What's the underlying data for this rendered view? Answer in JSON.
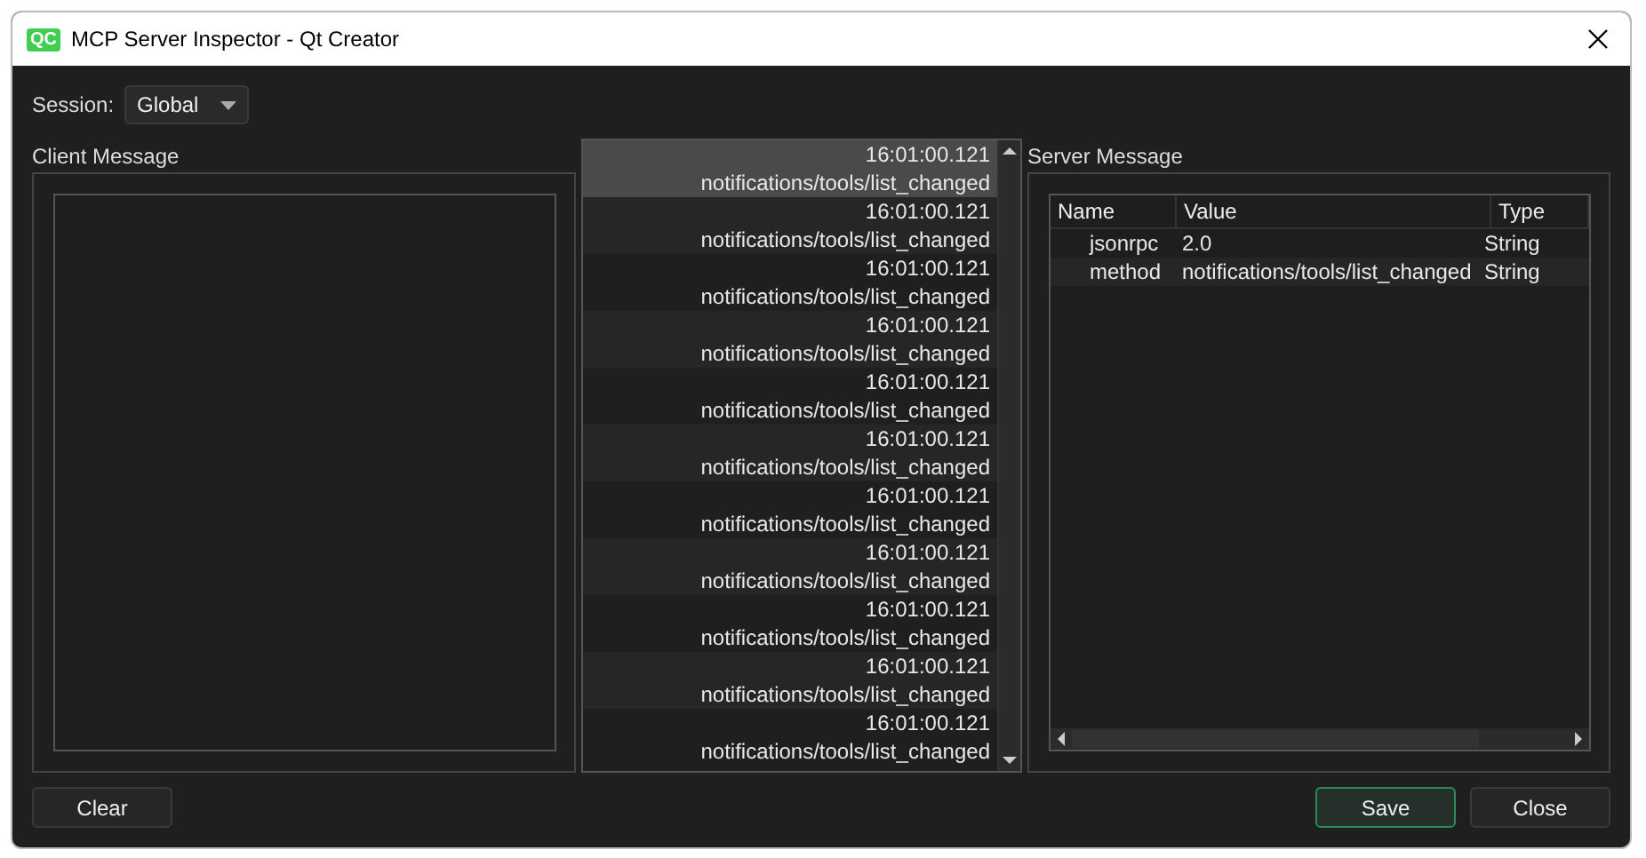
{
  "window": {
    "title": "MCP Server Inspector - Qt Creator",
    "icon_text": "QC"
  },
  "session": {
    "label": "Session:",
    "value": "Global"
  },
  "client_message": {
    "label": "Client Message"
  },
  "messages": [
    {
      "time": "16:01:00.121",
      "method": "notifications/tools/list_changed",
      "selected": true
    },
    {
      "time": "16:01:00.121",
      "method": "notifications/tools/list_changed",
      "selected": false
    },
    {
      "time": "16:01:00.121",
      "method": "notifications/tools/list_changed",
      "selected": false
    },
    {
      "time": "16:01:00.121",
      "method": "notifications/tools/list_changed",
      "selected": false
    },
    {
      "time": "16:01:00.121",
      "method": "notifications/tools/list_changed",
      "selected": false
    },
    {
      "time": "16:01:00.121",
      "method": "notifications/tools/list_changed",
      "selected": false
    },
    {
      "time": "16:01:00.121",
      "method": "notifications/tools/list_changed",
      "selected": false
    },
    {
      "time": "16:01:00.121",
      "method": "notifications/tools/list_changed",
      "selected": false
    },
    {
      "time": "16:01:00.121",
      "method": "notifications/tools/list_changed",
      "selected": false
    },
    {
      "time": "16:01:00.121",
      "method": "notifications/tools/list_changed",
      "selected": false
    },
    {
      "time": "16:01:00.121",
      "method": "notifications/tools/list_changed",
      "selected": false
    }
  ],
  "server_message": {
    "label": "Server Message",
    "columns": [
      "Name",
      "Value",
      "Type"
    ],
    "rows": [
      {
        "name": "jsonrpc",
        "value": "2.0",
        "type": "String"
      },
      {
        "name": "method",
        "value": "notifications/tools/list_changed",
        "type": "String"
      }
    ]
  },
  "buttons": {
    "clear": "Clear",
    "save": "Save",
    "close": "Close"
  }
}
